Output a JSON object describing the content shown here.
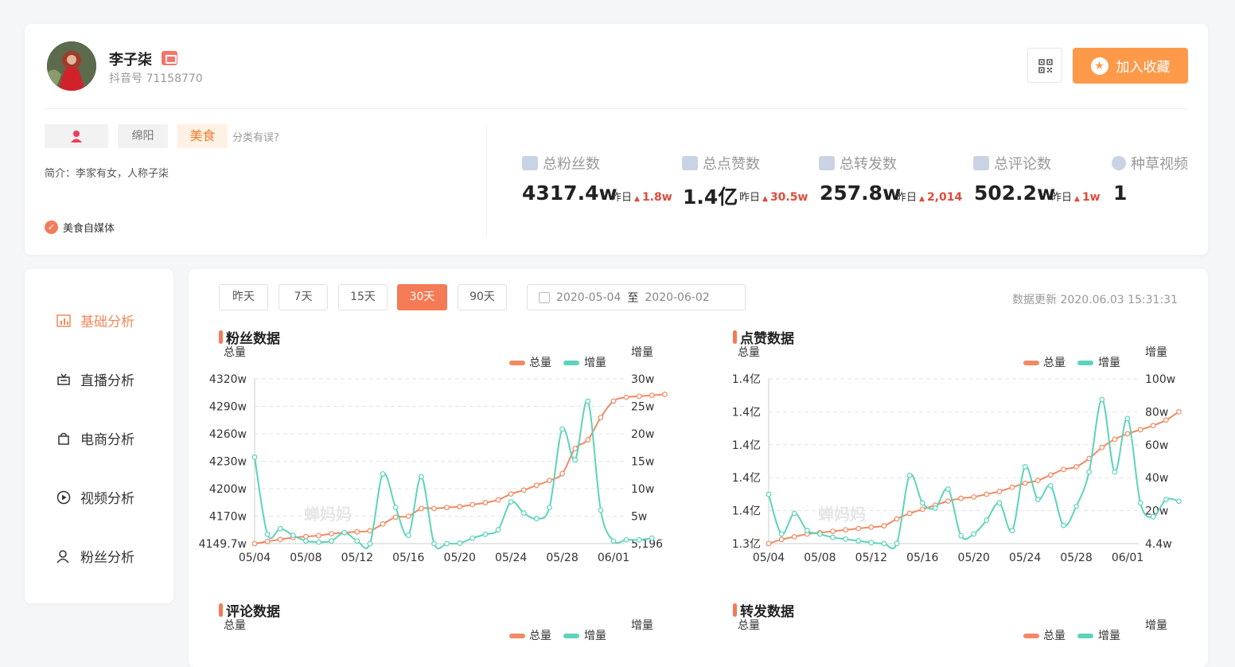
{
  "profile": {
    "name": "李子柒",
    "douyin_id": "抖音号 71158770",
    "fav_label": "加入收藏",
    "city": "绵阳",
    "category": "美食",
    "category_error": "分类有误?",
    "intro": "简介：李家有女，人称子柒",
    "badge": "美食自媒体"
  },
  "stats": [
    {
      "label": "总粉丝数",
      "value": "4317.4w",
      "yesterday": "昨日",
      "delta": "1.8w"
    },
    {
      "label": "总点赞数",
      "value": "1.4亿",
      "yesterday": "昨日",
      "delta": "30.5w"
    },
    {
      "label": "总转发数",
      "value": "257.8w",
      "yesterday": "昨日",
      "delta": "2,014"
    },
    {
      "label": "总评论数",
      "value": "502.2w",
      "yesterday": "昨日",
      "delta": "1w"
    },
    {
      "label": "种草视频",
      "value": "1"
    }
  ],
  "nav": {
    "items": [
      "基础分析",
      "直播分析",
      "电商分析",
      "视频分析",
      "粉丝分析"
    ],
    "active": "基础分析"
  },
  "toolbar": {
    "ranges": [
      "昨天",
      "7天",
      "15天",
      "30天",
      "90天"
    ],
    "active_range": "30天",
    "date_start": "2020-05-04",
    "date_to": "至",
    "date_end": "2020-06-02",
    "update_time": "数据更新 2020.06.03 15:31:31"
  },
  "colors": {
    "total": "#f08a64",
    "increment": "#5dd3bb",
    "accent": "#f57a56"
  },
  "chart_data": [
    {
      "title": "粉丝数据",
      "type": "line",
      "left_axis_label": "总量",
      "right_axis_label": "增量",
      "left_ticks": [
        "4320w",
        "4290w",
        "4260w",
        "4230w",
        "4200w",
        "4170w",
        "4149.7w"
      ],
      "right_ticks": [
        "30w",
        "25w",
        "20w",
        "15w",
        "10w",
        "5w",
        "5,196"
      ],
      "x_ticks": [
        "05/04",
        "05/08",
        "05/12",
        "05/16",
        "05/20",
        "05/24",
        "05/28",
        "06/01"
      ],
      "legend": [
        "总量",
        "增量"
      ],
      "watermark": "蝉妈妈",
      "series": [
        {
          "name": "总量",
          "axis": "left",
          "values": [
            4149.7,
            4152,
            4154,
            4156,
            4157,
            4158,
            4160,
            4161,
            4162,
            4163,
            4170,
            4177,
            4178,
            4186,
            4186,
            4187,
            4188,
            4190,
            4192,
            4195,
            4201,
            4205,
            4210,
            4215,
            4222,
            4248,
            4257,
            4280,
            4297,
            4301,
            4302,
            4303,
            4304
          ]
        },
        {
          "name": "增量",
          "axis": "right",
          "values": [
            16,
            2.2,
            3.2,
            2.0,
            1.0,
            0.8,
            1.0,
            2.5,
            1.0,
            0.5,
            13,
            7,
            2,
            12.5,
            0.5,
            0.2,
            0.6,
            1.5,
            2.2,
            3,
            8,
            6,
            5,
            7,
            21,
            15.5,
            26,
            6.5,
            1.0,
            1.2,
            1.2,
            1.5
          ]
        }
      ]
    },
    {
      "title": "点赞数据",
      "type": "line",
      "left_axis_label": "总量",
      "right_axis_label": "增量",
      "left_ticks": [
        "1.4亿",
        "1.4亿",
        "1.4亿",
        "1.4亿",
        "1.4亿",
        "1.3亿"
      ],
      "right_ticks": [
        "100w",
        "80w",
        "60w",
        "40w",
        "20w",
        "4.4w"
      ],
      "x_ticks": [
        "05/04",
        "05/08",
        "05/12",
        "05/16",
        "05/20",
        "05/24",
        "05/28",
        "06/01"
      ],
      "legend": [
        "总量",
        "增量"
      ],
      "watermark": "蝉妈妈",
      "series": [
        {
          "name": "总量",
          "axis": "left",
          "values": [
            0,
            3,
            5,
            7,
            8,
            9,
            10,
            11,
            12,
            13,
            18,
            22,
            25,
            28,
            31,
            33,
            34,
            36,
            38,
            41,
            44,
            46,
            50,
            54,
            56,
            62,
            70,
            76,
            80,
            83,
            86,
            90,
            96
          ]
        },
        {
          "name": "增量",
          "axis": "right",
          "values": [
            33,
            10,
            22,
            12,
            10,
            8,
            7,
            6,
            5,
            4,
            4.5,
            44,
            28,
            25,
            36,
            9,
            10,
            18,
            28,
            12,
            49,
            30,
            38,
            15,
            26,
            46,
            88,
            46,
            77,
            28,
            20,
            30,
            29
          ]
        }
      ]
    },
    {
      "title": "评论数据",
      "type": "line",
      "left_axis_label": "总量",
      "right_axis_label": "增量",
      "legend": [
        "总量",
        "增量"
      ],
      "series": []
    },
    {
      "title": "转发数据",
      "type": "line",
      "left_axis_label": "总量",
      "right_axis_label": "增量",
      "legend": [
        "总量",
        "增量"
      ],
      "series": []
    }
  ]
}
